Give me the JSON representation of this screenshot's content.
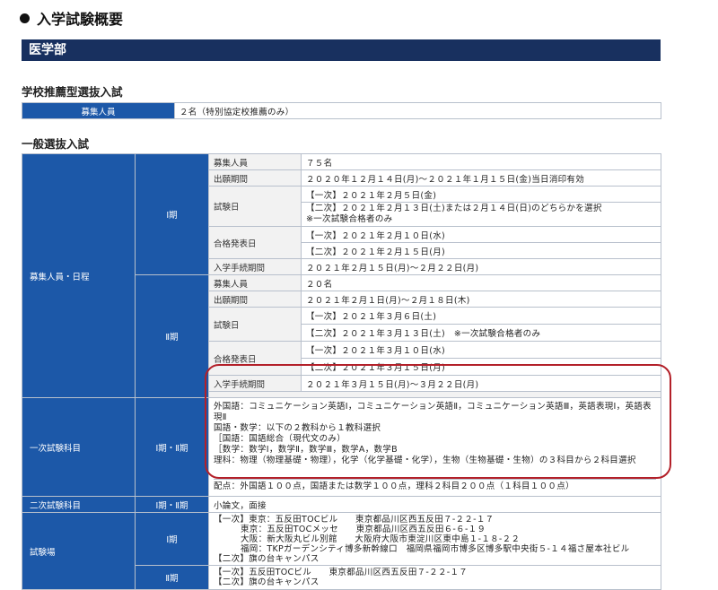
{
  "page_title": "入学試験概要",
  "department": "医学部",
  "school_recommend": {
    "heading": "学校推薦型選抜入試",
    "label": "募集人員",
    "value": "２名（特別協定校推薦のみ）"
  },
  "general": {
    "heading": "一般選抜入試",
    "group_schedule": "募集人員・日程",
    "period1": {
      "label": "Ⅰ期",
      "capacity_label": "募集人員",
      "capacity": "７５名",
      "application_label": "出願期間",
      "application": "２０２０年１２月１４日(月)～２０２１年１月１５日(金)当日消印有効",
      "exam_label": "試験日",
      "exam_first": "【一次】２０２１年２月５日(金)",
      "exam_second": "【二次】２０２１年２月１３日(土)または２月１４日(日)のどちらかを選択",
      "exam_second_note": "※一次試験合格者のみ",
      "result_label": "合格発表日",
      "result_first": "【一次】２０２１年２月１０日(水)",
      "result_second": "【二次】２０２１年２月１５日(月)",
      "procedure_label": "入学手続期間",
      "procedure": "２０２１年２月１５日(月)～２月２２日(月)"
    },
    "period2": {
      "label": "Ⅱ期",
      "capacity_label": "募集人員",
      "capacity": "２０名",
      "application_label": "出願期間",
      "application": "２０２１年２月１日(月)～２月１８日(木)",
      "exam_label": "試験日",
      "exam_first": "【一次】２０２１年３月６日(土)",
      "exam_second": "【二次】２０２１年３月１３日(土)　※一次試験合格者のみ",
      "result_label": "合格発表日",
      "result_first": "【一次】２０２１年３月１０日(水)",
      "result_second": "【二次】２０２１年３月１５日(月)",
      "procedure_label": "入学手続期間",
      "procedure": "２０２１年３月１５日(月)～３月２２日(月)"
    },
    "first_subjects": {
      "label": "一次試験科目",
      "period": "Ⅰ期・Ⅱ期",
      "lines": [
        "外国語：コミュニケーション英語Ⅰ，コミュニケーション英語Ⅱ，コミュニケーション英語Ⅲ，英語表現Ⅰ，英語表現Ⅱ",
        "国語・数学：以下の２教科から１教科選択",
        "［国語：国語総合（現代文のみ）",
        "［数学：数学Ⅰ，数学Ⅱ，数学Ⅲ，数学A，数学B",
        "理科：物理（物理基礎・物理），化学（化学基礎・化学），生物（生物基礎・生物）の３科目から２科目選択"
      ],
      "score": "配点：外国語１００点，国語または数学１００点，理科２科目２００点（１科目１００点）"
    },
    "second_subjects": {
      "label": "二次試験科目",
      "period": "Ⅰ期・Ⅱ期",
      "value": "小論文，面接"
    },
    "venue": {
      "label": "試験場",
      "period1_label": "Ⅰ期",
      "period1_lines": [
        "【一次】東京：五反田TOCビル　　東京都品川区西五反田７-２２-１７",
        "東京：五反田TOCメッセ　　東京都品川区西五反田６-６-１９",
        "大阪：新大阪丸ビル別館　　大阪府大阪市東淀川区東中島１-１８-２２",
        "福岡：TKPガーデンシティ博多新幹線口　福岡県福岡市博多区博多駅中央街５-１４福さ屋本社ビル",
        "【二次】旗の台キャンパス"
      ],
      "period2_label": "Ⅱ期",
      "period2_lines": [
        "【一次】五反田TOCビル　　東京都品川区西五反田７-２２-１７",
        "【二次】旗の台キャンパス"
      ]
    }
  }
}
